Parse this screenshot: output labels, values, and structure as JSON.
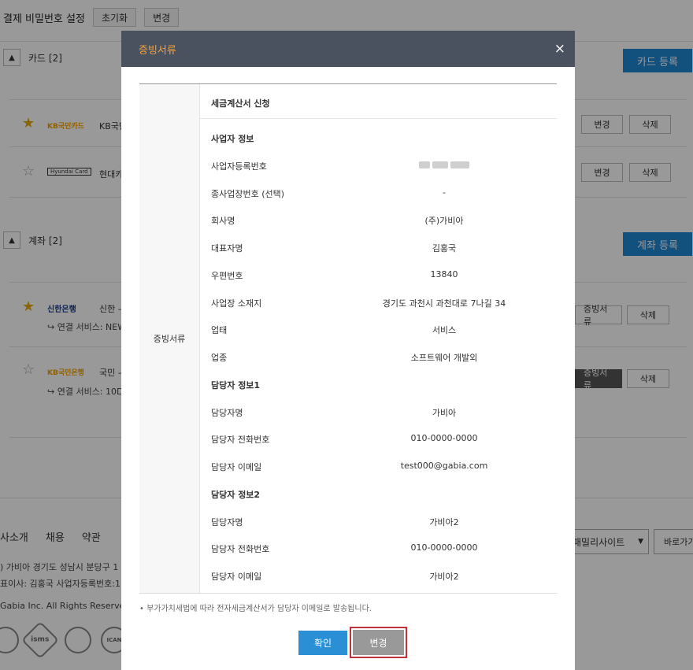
{
  "page": {
    "top_title": "결제 비밀번호 설정",
    "reset_btn": "초기화",
    "change_btn": "변경",
    "cards_section": "카드 [2]",
    "card_register": "카드 등록",
    "cards": [
      {
        "logo": "KB국민카드",
        "name": "KB국민",
        "change": "변경",
        "delete": "삭제"
      },
      {
        "logo": "Hyundai Card",
        "name": "현대카",
        "change": "변경",
        "delete": "삭제"
      }
    ],
    "accounts_section": "계좌 [2]",
    "account_register": "계좌 등록",
    "accounts": [
      {
        "logo": "신한은행",
        "name": "신한 –",
        "service": "↪  연결 서비스: NEW",
        "doc": "증빙서류",
        "delete": "삭제"
      },
      {
        "logo": "KB국민은행",
        "name": "국민 –",
        "service": "↪  연결 서비스: 10D",
        "doc": "증빙서류",
        "delete": "삭제"
      }
    ],
    "footer_links": [
      "사소개",
      "채용",
      "약관"
    ],
    "footer_line1": ") 가비아      경기도 성남시 분당구 1",
    "footer_line2": "표이사: 김홍국      사업자등록번호:1",
    "copyright": "Gabia Inc. All Rights Reserved.",
    "family_select": "패밀리사이트",
    "goto_btn": "바로가기",
    "badges": [
      "",
      "isms",
      "",
      "ICAN"
    ]
  },
  "modal": {
    "title": "증빙서류",
    "close_icon": "×",
    "left_label": "증빙서류",
    "doc_title": "세금계산서 신청",
    "rows": [
      {
        "label": "사업자 정보",
        "value": "",
        "head": true
      },
      {
        "label": "사업자등록번호",
        "value": "",
        "blurred": true
      },
      {
        "label": "종사업장번호 (선택)",
        "value": "-"
      },
      {
        "label": "회사명",
        "value": "(주)가비아"
      },
      {
        "label": "대표자명",
        "value": "김홍국"
      },
      {
        "label": "우편번호",
        "value": "13840"
      },
      {
        "label": "사업장 소재지",
        "value": "경기도 과천시 과천대로 7나길 34"
      },
      {
        "label": "업태",
        "value": "서비스"
      },
      {
        "label": "업종",
        "value": "소프트웨어 개발외"
      },
      {
        "label": "담당자 정보1",
        "value": "",
        "head": true
      },
      {
        "label": "담당자명",
        "value": "가비아"
      },
      {
        "label": "담당자 전화번호",
        "value": "010-0000-0000"
      },
      {
        "label": "담당자 이메일",
        "value": "test000@gabia.com"
      },
      {
        "label": "담당자 정보2",
        "value": "",
        "head": true
      },
      {
        "label": "담당자명",
        "value": "가비아2"
      },
      {
        "label": "담당자 전화번호",
        "value": "010-0000-0000"
      },
      {
        "label": "담당자 이메일",
        "value": "가비아2"
      }
    ],
    "note": "•  부가가치세법에 따라 전자세금계산서가 담당자 이메일로 발송됩니다.",
    "confirm_btn": "확인",
    "change_btn": "변경"
  },
  "colors": {
    "overlay": "rgba(0,0,0,0.4)",
    "modal_header": "#4a5260",
    "modal_title": "#f3a23a",
    "primary": "#2b8fd6",
    "highlight_border": "#c0323a"
  }
}
